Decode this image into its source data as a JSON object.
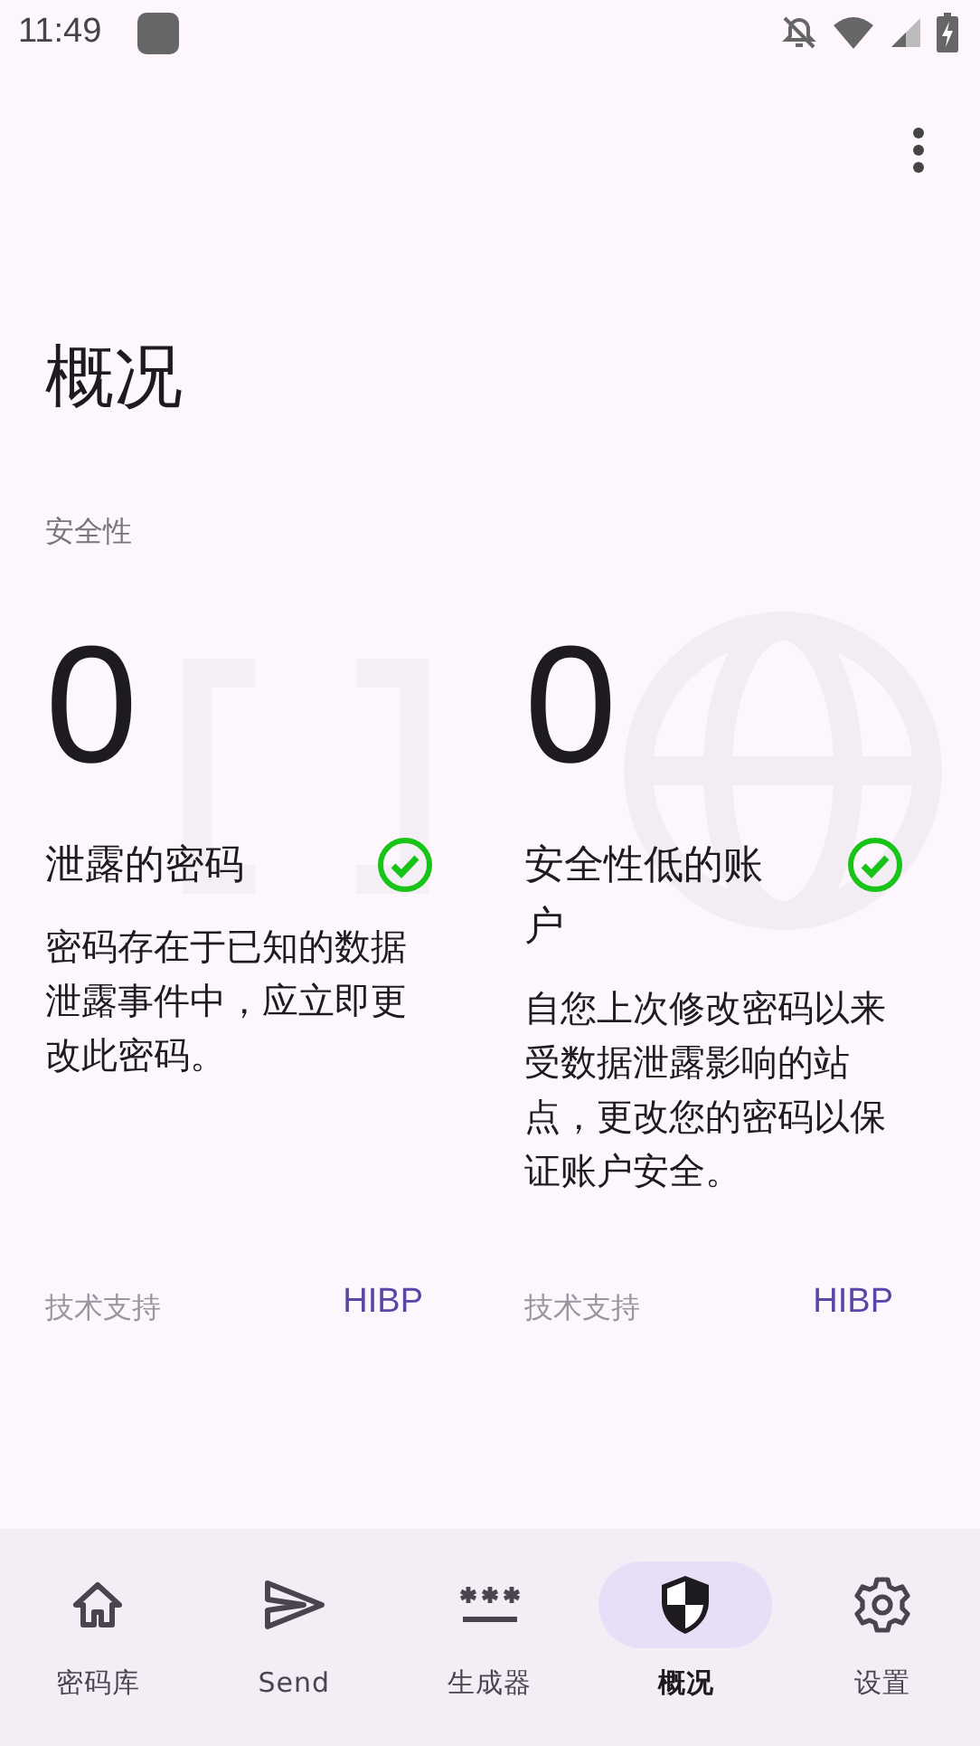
{
  "status_bar": {
    "time": "11:49"
  },
  "title": "概况",
  "section_label": "安全性",
  "cards": [
    {
      "count": "0",
      "title": "泄露的密码",
      "ok": true,
      "description": "密码存在于已知的数据泄露事件中，应立即更改此密码。",
      "footer_label": "技术支持",
      "footer_link": "HIBP"
    },
    {
      "count": "0",
      "title": "安全性低的账户",
      "ok": true,
      "description": "自您上次修改密码以来受数据泄露影响的站点，更改您的密码以保证账户安全。",
      "footer_label": "技术支持",
      "footer_link": "HIBP"
    }
  ],
  "nav": [
    {
      "label": "密码库",
      "selected": false
    },
    {
      "label": "Send",
      "selected": false
    },
    {
      "label": "生成器",
      "selected": false
    },
    {
      "label": "概况",
      "selected": true
    },
    {
      "label": "设置",
      "selected": false
    }
  ]
}
